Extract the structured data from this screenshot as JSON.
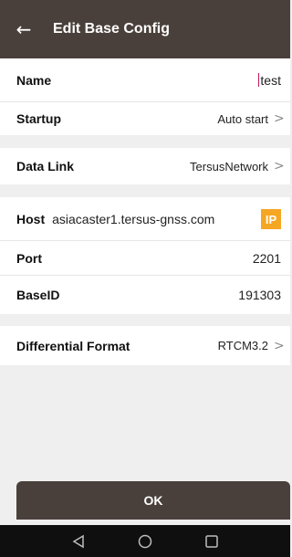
{
  "header": {
    "back_icon": "arrow-left-icon",
    "title": "Edit Base Config"
  },
  "fields": {
    "name": {
      "label": "Name",
      "value": "test"
    },
    "startup": {
      "label": "Startup",
      "value": "Auto start",
      "chevron": ">"
    },
    "data_link": {
      "label": "Data Link",
      "value": "TersusNetwork",
      "chevron": ">"
    },
    "host": {
      "label": "Host",
      "value": "asiacaster1.tersus-gnss.com",
      "badge": "IP"
    },
    "port": {
      "label": "Port",
      "value": "2201"
    },
    "base_id": {
      "label": "BaseID",
      "value": "191303"
    },
    "diff_format": {
      "label": "Differential Format",
      "value": "RTCM3.2",
      "chevron": ">"
    }
  },
  "ok_button": {
    "label": "OK"
  },
  "colors": {
    "header_bg": "#4a403b",
    "badge": "#f5a623",
    "cursor": "#c2185b"
  },
  "navbar": {
    "icons": [
      "back-triangle-icon",
      "home-circle-icon",
      "recents-square-icon"
    ]
  }
}
